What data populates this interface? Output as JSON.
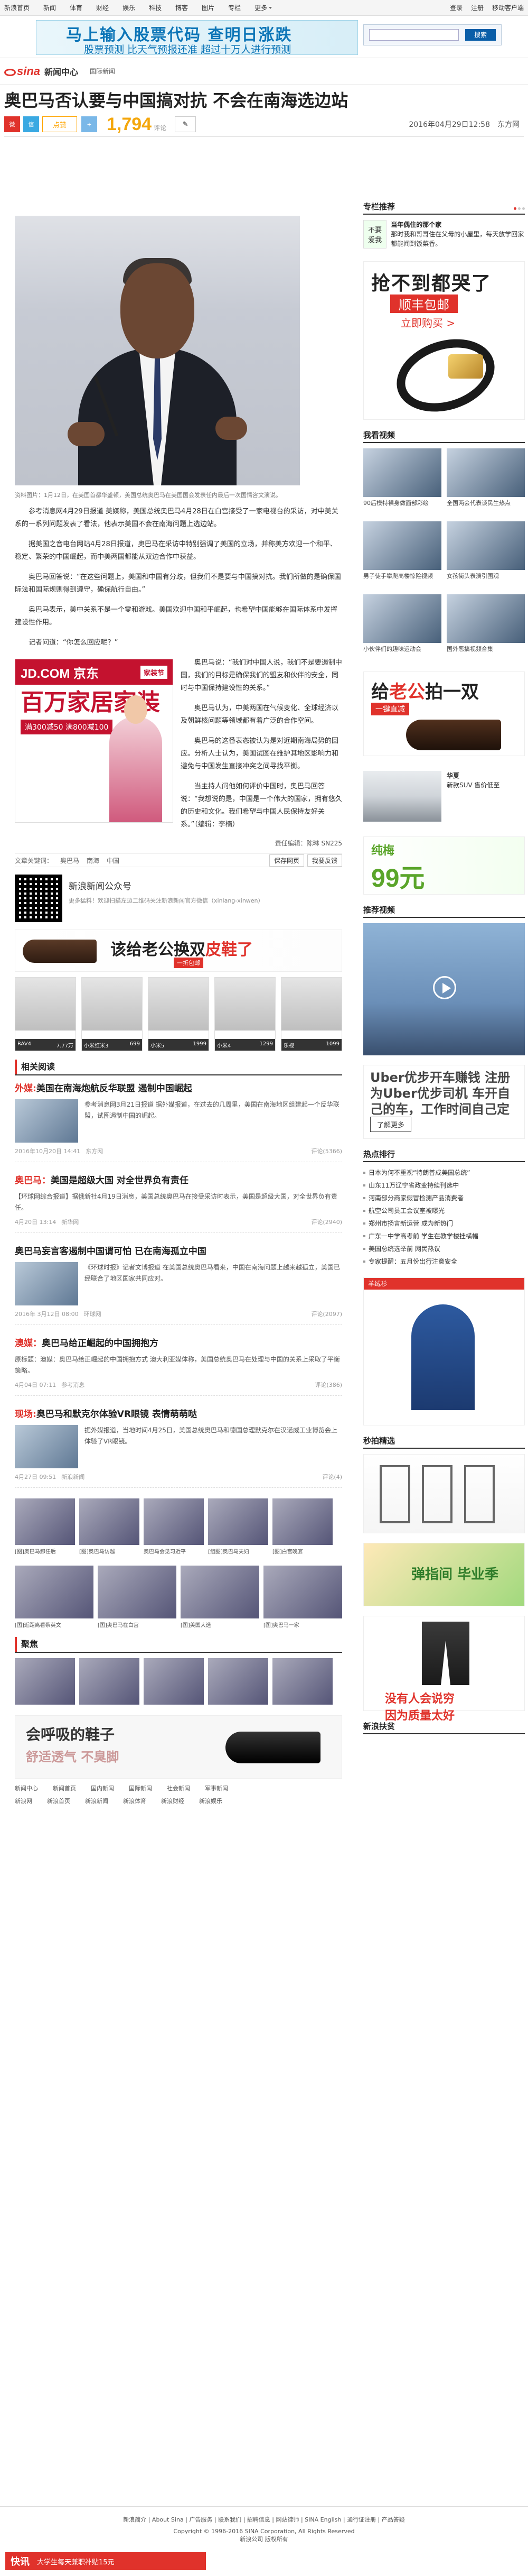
{
  "topnav": {
    "items": [
      "新浪首页",
      "新闻",
      "体育",
      "财经",
      "娱乐",
      "科技",
      "博客",
      "图片",
      "专栏",
      "更多"
    ],
    "right": [
      "登录",
      "注册",
      "移动客户端"
    ]
  },
  "banner": {
    "line1": "马上输入股票代码  查明日涨跌",
    "line2": "股票预测 比天气预报还准 超过十万人进行预测",
    "search_placeholder": "",
    "search_button": "搜索"
  },
  "channel": {
    "logo_text": "sina",
    "logo_center": "新闻中心",
    "sub": "国际新闻"
  },
  "headline": "奥巴马否认要与中国搞对抗 不会在南海选边站",
  "share": {
    "like": "点赞",
    "count": "1,794",
    "count_label": "评论",
    "date": "2016年04月29日12:58",
    "source": "东方网"
  },
  "photo_caption": "资料图片：1月12日，在美国首都华盛顿，美国总统奥巴马在美国国会发表任内最后一次国情咨文演说。",
  "paras": [
    "参考消息网4月29日报道 美媒称，美国总统奥巴马4月28日在白宫接受了一家电视台的采访，对中美关系的一系列问题发表了看法，他表示美国不会在南海问题上选边站。",
    "据美国之音电台网站4月28日报道，奥巴马在采访中特别强调了美国的立场，并称美方欢迎一个和平、稳定、繁荣的中国崛起，而中美两国都能从双边合作中获益。",
    "奥巴马回答说：“在这些问题上，美国和中国有分歧，但我们不是要与中国搞对抗。我们所做的是确保国际法和国际规则得到遵守，确保航行自由。”",
    "奥巴马表示，美中关系不是一个零和游戏。美国欢迎中国和平崛起，也希望中国能够在国际体系中发挥建设性作用。",
    "记者问道：“你怎么回应呢？”",
    "奥巴马说：“我们对中国人说，我们不是要遏制中国，我们的目标是确保我们的盟友和伙伴的安全，同时与中国保持建设性的关系。”",
    "奥巴马认为，中美两国在气候变化、全球经济以及朝鲜核问题等领域都有着广泛的合作空间。",
    "奥巴马的这番表态被认为是对近期南海局势的回应。分析人士认为，美国试图在维护其地区影响力和避免与中国发生直接冲突之间寻找平衡。",
    "当主持人问他如何评价中国时，奥巴马回答说：“我想说的是，中国是一个伟大的国家，拥有悠久的历史和文化。我们希望与中国人民保持友好关系。”（编辑：李楠）"
  ],
  "jd_ad": {
    "logo": "JD.COM 京东",
    "tag": "家装节",
    "big": "百万家居家装",
    "sub": "满300减50  满800减100"
  },
  "editor": "责任编辑：陈琳 SN225",
  "tags": {
    "label": "文章关键词：",
    "items": [
      "奥巴马",
      "南海",
      "中国"
    ],
    "buttons": [
      "保存网页",
      "我要反馈"
    ]
  },
  "qr": {
    "t1": "新浪新闻公众号",
    "t2": "更多猛料！欢迎扫描左边二维码关注新浪新闻官方微信（xinlang-xinwen）"
  },
  "shoe_ad": {
    "text1": "该给老公换双",
    "text2": "皮鞋了",
    "sub": "一折包邮"
  },
  "products": [
    {
      "label": "RAV4",
      "price": "7.77万"
    },
    {
      "label": "小米红米3",
      "price": "699"
    },
    {
      "label": "小米5",
      "price": "1999"
    },
    {
      "label": "小米4",
      "price": "1299"
    },
    {
      "label": "乐视",
      "price": "1099"
    }
  ],
  "related": {
    "title": "相关阅读",
    "news": [
      {
        "tag": "外媒:",
        "title": "美国在南海炮航反华联盟 遏制中国崛起",
        "desc": "参考消息网3月21日报道 据外媒报道，在过去的几周里，美国在南海地区组建起一个反华联盟，试图遏制中国的崛起。",
        "date": "2016年10月20日 14:41",
        "src": "东方网",
        "r": "评论(5366)"
      },
      {
        "tag": "奥巴马：",
        "title": "美国是超级大国 对全世界负有责任",
        "desc": "【环球网综合报道】据俄新社4月19日消息，美国总统奥巴马在接受采访时表示，美国是超级大国，对全世界负有责任。",
        "date": "4月20日 13:14",
        "src": "新华网",
        "r": "评论(2940)"
      },
      {
        "tag": "",
        "title": "奥巴马妄言客遏制中国谓可怕 已在南海孤立中国",
        "desc": "《环球时报》记者文博报道 在美国总统奥巴马看来，中国在南海问题上越来越孤立，美国已经联合了地区国家共同应对。",
        "date": "2016年 3月12日 08:00",
        "src": "环球网",
        "r": "评论(2097)"
      },
      {
        "tag": "澳媒：",
        "title": "奥巴马给正崛起的中国拥抱方",
        "desc": "原标题：澳媒：奥巴马给正崛起的中国拥抱方式 澳大利亚媒体称，美国总统奥巴马在处理与中国的关系上采取了平衡策略。",
        "date": "4月04日 07:11",
        "src": "参考消息",
        "r": "评论(386)"
      },
      {
        "tag": "现场:",
        "title": "奥巴马和默克尔体验VR眼镜 表情萌萌哒",
        "desc": "据外媒报道，当地时间4月25日，美国总统奥巴马和德国总理默克尔在汉诺威工业博览会上体验了VR眼镜。",
        "date": "4月27日 09:51",
        "src": "新浪新闻",
        "r": "评论(4)"
      }
    ]
  },
  "pic_caps": [
    "[图]奥巴马卸任后",
    "[图]奥巴马访越",
    "奥巴马会见习近平",
    "[组图]奥巴马夫妇",
    "[图]白宫晚宴"
  ],
  "pic_caps2": [
    "[图]近距离看蔡英文",
    "[图]奥巴马在白宫",
    "[图]美国大选",
    "[图]奥巴马一家"
  ],
  "more_label": "聚焦",
  "bottom_ad": {
    "t": "会呼吸的鞋子",
    "s": "舒适透气 不臭脚"
  },
  "bottom_nav": [
    [
      "新闻中心",
      "新闻首页",
      "国内新闻",
      "国际新闻",
      "社会新闻",
      "军事新闻"
    ],
    [
      "新浪网",
      "新浪首页",
      "新浪新闻",
      "新浪体育",
      "新浪财经",
      "新浪娱乐"
    ]
  ],
  "sidebar": {
    "column_title": "专栏推荐",
    "column_item": {
      "avatar1": "不要",
      "avatar2": "爱我",
      "title": "当年偶住的那个家",
      "desc": "那时我和哥哥住在父母的小屋里，每天放学回家都能闻到饭菜香。"
    },
    "belt_ad": {
      "h1": "抢不到都哭了",
      "h2": "顺丰包邮",
      "h3": "立即购买 >"
    },
    "video_title": "我看视频",
    "videos": [
      "90后模特裸身做面部彩绘",
      "全国两会代表谈民生热点",
      "男子徒手攀爬高楼惊险视频",
      "女孩街头表演引围观",
      "小伙伴们的趣味运动会",
      "国外恶搞视频合集"
    ],
    "gift_ad": {
      "t1": "给",
      "t2": "老公",
      "t3": "拍一双",
      "tag": "一键直减"
    },
    "suv": {
      "title": "华夏",
      "desc": "新款SUV 售价低至"
    },
    "square_ad": {
      "t": "纯梅",
      "p": "99元"
    },
    "rec_title": "推荐视频",
    "uber": {
      "t": "Uber优步开车赚钱 注册为Uber优步司机 车开自己的车，工作时间自己定",
      "btn": "了解更多"
    },
    "hot_title": "热点排行",
    "hot": [
      "日本为何不重视“特朗普成美国总统”",
      "山东11万辽宁省政变持续刊选中",
      "河南部分商家假冒检测产品消费者",
      "航空公司员工会议室被曝光",
      "郑州市扬言新运营 成为新热门",
      "广东一中学高考前 学生在教学楼挂横幅",
      "美国总统选举前 网民热议",
      "专家提醒：五月份出行注意安全"
    ],
    "sheep_ad": "羊绒衫",
    "pics_title": "秒拍精选",
    "grad_ad": "弹指间  毕业季",
    "pants_ad": {
      "t": "没有人会说穷",
      "s": "因为质量太好"
    },
    "bottom_title": "新浪扶贫"
  },
  "footer": {
    "links": "新浪简介 | About Sina | 广告服务 | 联系我们 | 招聘信息 | 网站律师 | SINA English | 通行证注册 | 产品答疑",
    "copyright": "Copyright © 1996-2016 SINA Corporation, All Rights Reserved",
    "sub": "新浪公司 版权所有",
    "bar_q": "快讯",
    "bar_text": "大学生每天兼职补贴15元"
  }
}
